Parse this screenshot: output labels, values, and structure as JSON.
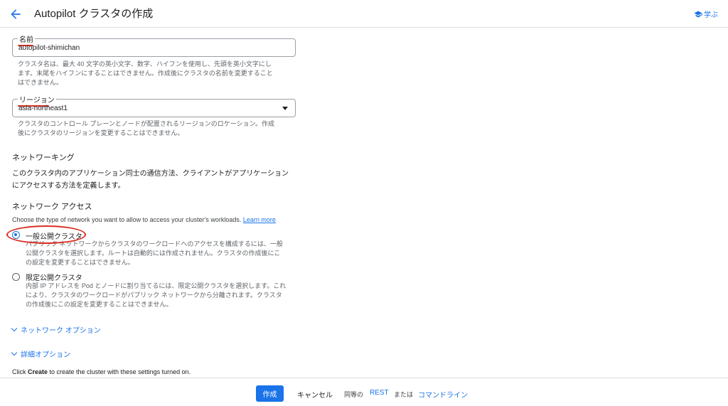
{
  "header": {
    "title": "Autopilot クラスタの作成",
    "back_icon": "arrow-back-icon",
    "learn_label": "学ぶ",
    "learn_icon": "graduation-cap-icon"
  },
  "name_field": {
    "label": "名前",
    "value": "autopilot-shimichan",
    "helper_lines": [
      "クラスタ名は、最大 40 文字の英小文字、数字、ハイフンを使用し、先頭を英小文字にし",
      "ます。末尾をハイフンにすることはできません。作成後にクラスタの名前を変更すること",
      "はできません。"
    ]
  },
  "region_field": {
    "label": "リージョン",
    "value": "asia-northeast1",
    "helper_lines": [
      "クラスタのコントロール プレーンとノードが配置されるリージョンのロケーション。作成",
      "後にクラスタのリージョンを変更することはできません。"
    ]
  },
  "networking": {
    "heading": "ネットワーキング",
    "description_lines": [
      "このクラスタ内のアプリケーション同士の通信方法、クライアントがアプリケーション",
      "にアクセスする方法を定義します。"
    ]
  },
  "network_access": {
    "heading": "ネットワーク アクセス",
    "description": "Choose the type of network you want to allow to access your cluster's workloads.",
    "learn_more": "Learn more",
    "options": [
      {
        "label": "一般公開クラスタ",
        "checked": true,
        "desc_lines": [
          "パブリック ネットワークからクラスタのワークロードへのアクセスを構成するには、一般",
          "公開クラスタを選択します。ルートは自動的には作成されません。クラスタの作成後にこ",
          "の設定を変更することはできません。"
        ]
      },
      {
        "label": "限定公開クラスタ",
        "checked": false,
        "desc_lines": [
          "内部 IP アドレスを Pod とノードに割り当てるには、限定公開クラスタを選択します。これ",
          "により、クラスタのワークロードがパブリック ネットワークから分離されます。クラスタ",
          "の作成後にこの設定を変更することはできません。"
        ]
      }
    ]
  },
  "expanders": [
    {
      "label": "ネットワーク オプション",
      "icon": "chevron-down-icon"
    },
    {
      "label": "詳細オプション",
      "icon": "chevron-down-icon"
    }
  ],
  "create_hint": {
    "prefix": "Click ",
    "bold": "Create",
    "suffix": " to create the cluster with these settings turned on."
  },
  "footer": {
    "create_label": "作成",
    "cancel_label": "キャンセル",
    "equivalent_label": "同等の",
    "rest_label": "REST",
    "or_label": "または",
    "cli_label": "コマンドライン"
  },
  "colors": {
    "accent": "#1a73e8",
    "annotation_red": "#d93025"
  }
}
